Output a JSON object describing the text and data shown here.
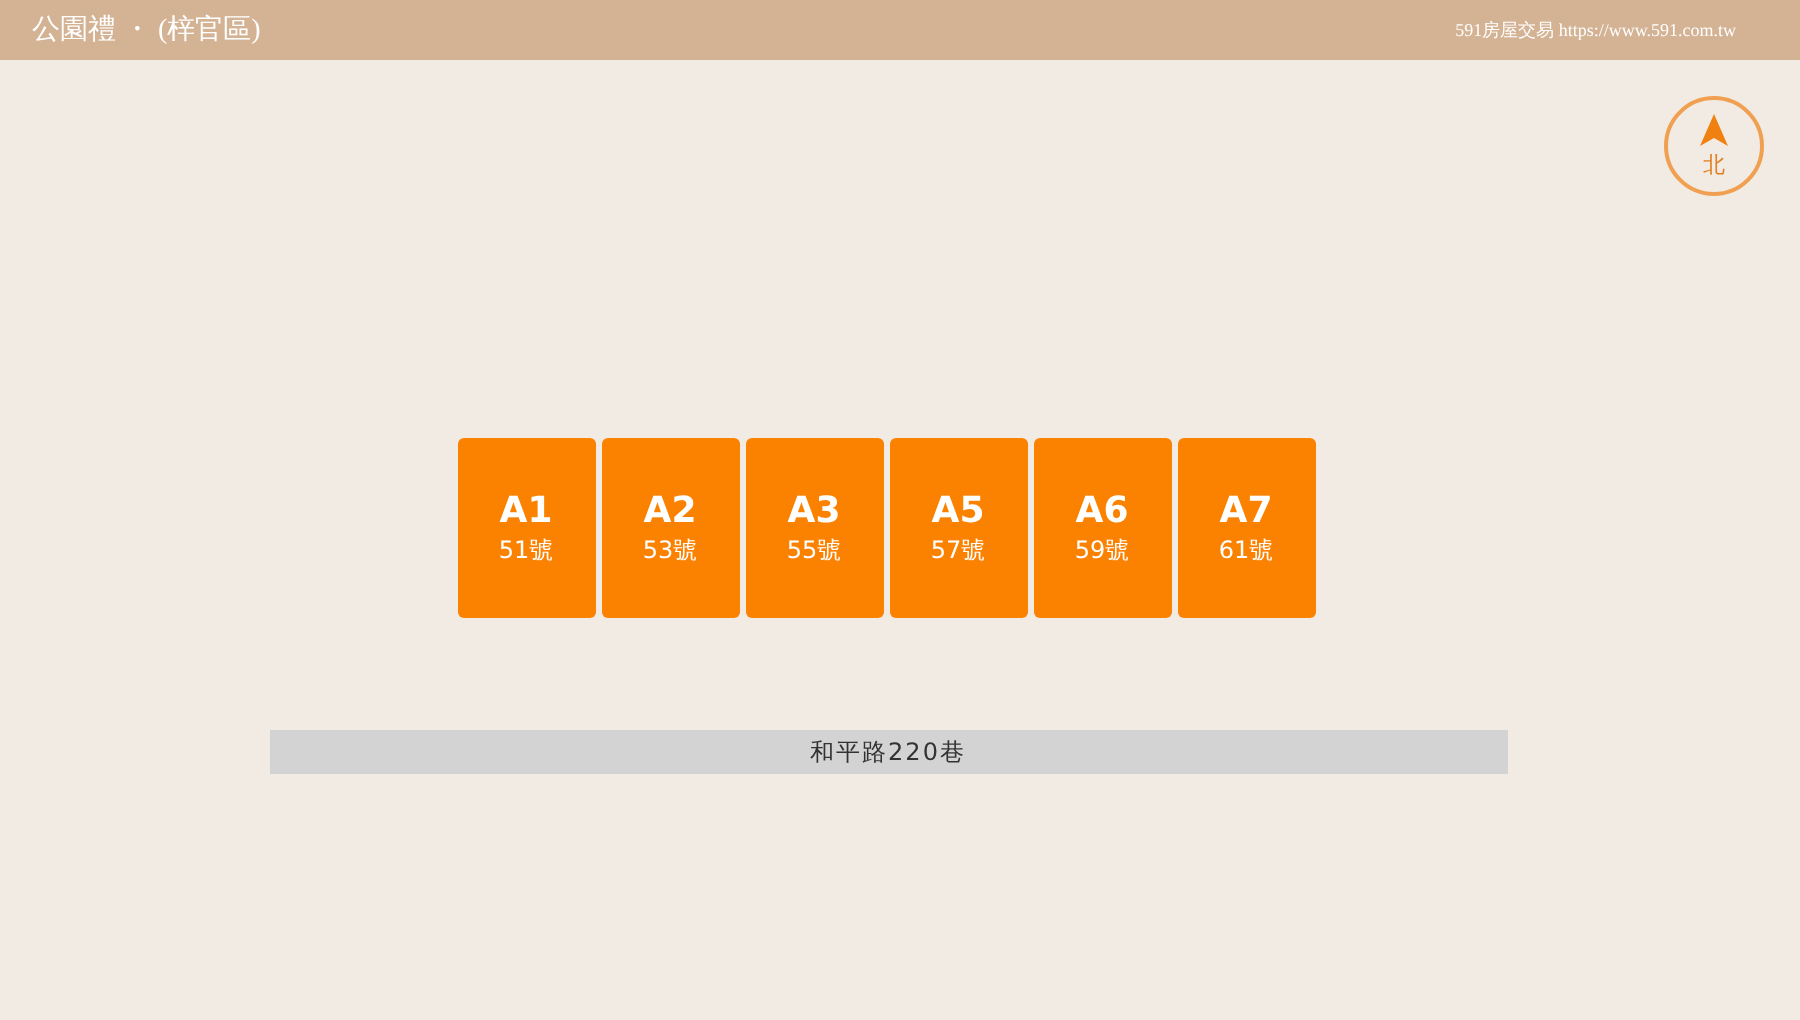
{
  "header": {
    "title": "公園禮 ・ (梓官區)",
    "site": "591房屋交易 https://www.591.com.tw"
  },
  "compass": {
    "label": "北"
  },
  "units": [
    {
      "code": "A1",
      "number": "51號"
    },
    {
      "code": "A2",
      "number": "53號"
    },
    {
      "code": "A3",
      "number": "55號"
    },
    {
      "code": "A5",
      "number": "57號"
    },
    {
      "code": "A6",
      "number": "59號"
    },
    {
      "code": "A7",
      "number": "61號"
    }
  ],
  "road": {
    "name": "和平路220巷"
  }
}
